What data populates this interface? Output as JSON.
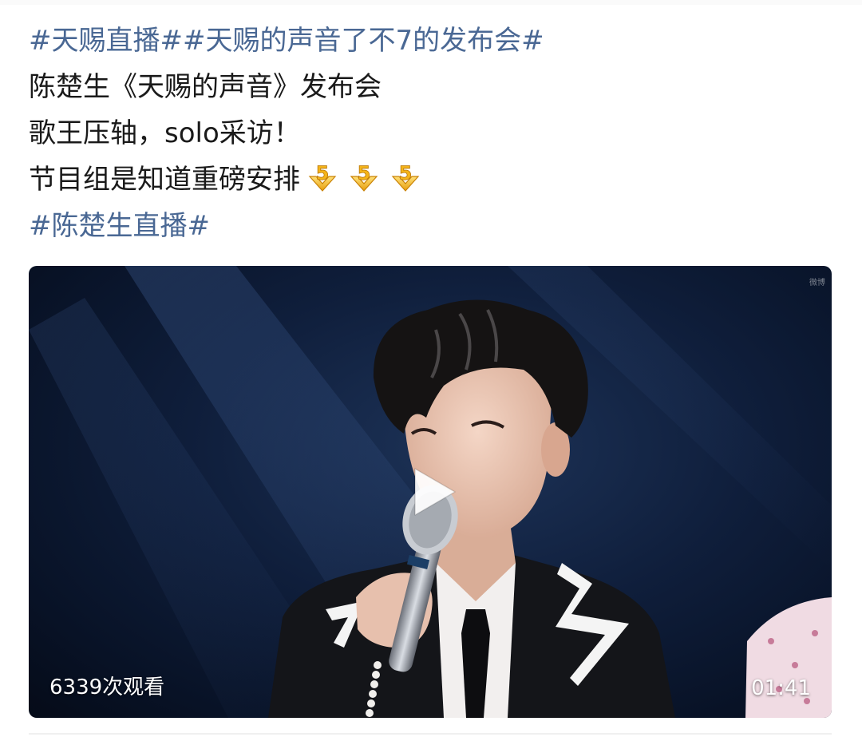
{
  "post": {
    "lines": [
      [
        {
          "text": "#天赐直播#",
          "type": "tag"
        },
        {
          "text": "#天赐的声音了不7的发布会#",
          "type": "tag"
        }
      ],
      [
        {
          "text": "陈楚生《天赐的声音》发布会",
          "type": "text"
        }
      ],
      [
        {
          "text": "歌王压轴，solo采访！",
          "type": "text"
        }
      ],
      [
        {
          "text": "节目组是知道重磅安排",
          "type": "text"
        }
      ],
      [
        {
          "text": "#陈楚生直播#",
          "type": "tag"
        }
      ]
    ],
    "emoji": {
      "icon": "number-5-emoji-icon",
      "count": 3,
      "color": "#f2b619"
    }
  },
  "video": {
    "views": "6339次观看",
    "duration": "01:41",
    "watermark": "微博",
    "play_icon": "play-icon"
  },
  "colors": {
    "tag": "#4a6894",
    "text": "#1a1a1a",
    "background": "#ffffff"
  }
}
